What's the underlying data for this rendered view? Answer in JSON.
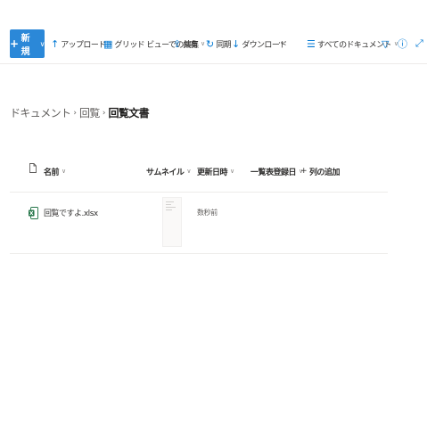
{
  "command_bar": {
    "new_label": "新規",
    "upload_label": "アップロード",
    "grid_edit_label": "グリッド ビューでの編集",
    "share_label": "共有",
    "sync_label": "同期",
    "download_label": "ダウンロード",
    "more_label": "···",
    "view_label": "すべてのドキュメント"
  },
  "breadcrumb": {
    "items": [
      "ドキュメント",
      "回覧"
    ],
    "current": "回覧文書"
  },
  "columns": {
    "name": "名前",
    "thumbnail": "サムネイル",
    "modified": "更新日時",
    "registered": "一覧表登録日",
    "add_column": "列の追加"
  },
  "files": [
    {
      "name": "回覧ですよ.xlsx",
      "modified": "数秒前",
      "type_icon": "excel-icon"
    }
  ],
  "colors": {
    "accent": "#0078d4",
    "new_button": "#2b88d8",
    "excel": "#217346"
  }
}
